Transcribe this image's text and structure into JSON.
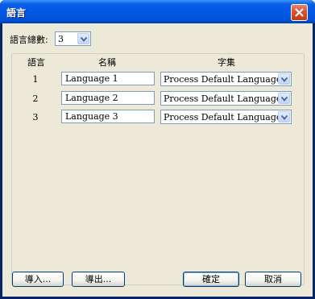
{
  "window": {
    "title": "語言"
  },
  "language_count": {
    "label": "語言總數:",
    "value": "3"
  },
  "table": {
    "headers": [
      "語言",
      "名稱",
      "字集"
    ],
    "rows": [
      {
        "num": "1",
        "name": "Language 1",
        "charset": "Process Default Language"
      },
      {
        "num": "2",
        "name": "Language 2",
        "charset": "Process Default Language"
      },
      {
        "num": "3",
        "name": "Language 3",
        "charset": "Process Default Language"
      }
    ]
  },
  "buttons": {
    "import": "導入...",
    "export": "導出...",
    "ok": "確定",
    "cancel": "取消"
  },
  "colors": {
    "title_bar": "#0058e6",
    "dialog_bg": "#ece9d8",
    "close_button": "#d8532f"
  },
  "icons": {
    "close": "close-icon",
    "dropdown": "chevron-down-icon"
  }
}
